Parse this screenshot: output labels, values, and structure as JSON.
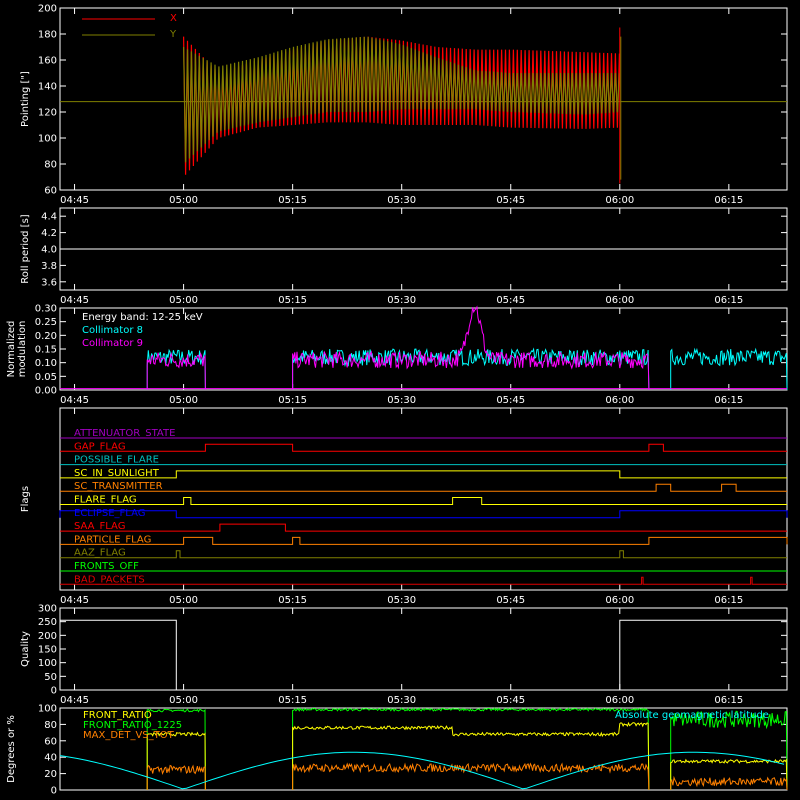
{
  "colors": {
    "red": "#ff0000",
    "olive": "#808000",
    "white": "#ffffff",
    "cyan": "#00ffff",
    "magenta": "#ff00ff",
    "yellow": "#ffff00",
    "orange": "#ff8000",
    "blue": "#0000ff",
    "green": "#00ff00",
    "purple": "#a000c0",
    "teal": "#00c0c0",
    "darkred": "#e00000"
  },
  "chart_data": [
    {
      "type": "line",
      "ylabel": "Pointing [\"]",
      "ylim": [
        60,
        200
      ],
      "yticks": [
        "60",
        "80",
        "100",
        "120",
        "140",
        "160",
        "180",
        "200"
      ],
      "xticks": [
        "04:45",
        "05:00",
        "05:15",
        "05:30",
        "05:45",
        "06:00",
        "06:15"
      ],
      "series": [
        {
          "name": "X",
          "color": "red",
          "envelope_upper": [
            178,
            150,
            160,
            168,
            175,
            178,
            175,
            170,
            168,
            168,
            166,
            165
          ],
          "envelope_lower": [
            70,
            100,
            108,
            110,
            112,
            112,
            110,
            110,
            110,
            108,
            107,
            108
          ]
        },
        {
          "name": "Y",
          "color": "olive",
          "envelope_upper": [
            170,
            155,
            162,
            170,
            176,
            178,
            172,
            162,
            152,
            150,
            150,
            150
          ],
          "envelope_lower": [
            80,
            105,
            112,
            116,
            120,
            120,
            122,
            122,
            122,
            120,
            118,
            120
          ]
        }
      ],
      "x_hours": [
        5.0,
        5.08,
        5.17,
        5.25,
        5.33,
        5.42,
        5.5,
        5.58,
        5.67,
        5.75,
        5.92,
        6.0
      ],
      "baseline": 128
    },
    {
      "type": "line",
      "ylabel": "Roll period [s]",
      "ylim": [
        3.5,
        4.5
      ],
      "yticks": [
        "3.6",
        "3.8",
        "4.0",
        "4.2",
        "4.4"
      ],
      "xticks": [
        "04:45",
        "05:00",
        "05:15",
        "05:30",
        "05:45",
        "06:00",
        "06:15"
      ],
      "series": [
        {
          "name": "",
          "color": "white",
          "x": [
            "04:43",
            "06:23"
          ],
          "y": [
            4.0,
            4.0
          ]
        }
      ]
    },
    {
      "type": "line",
      "ylabel": "Normalized modulation",
      "ylim": [
        0,
        0.3
      ],
      "yticks": [
        "0.00",
        "0.05",
        "0.10",
        "0.15",
        "0.20",
        "0.25",
        "0.30"
      ],
      "xticks": [
        "04:45",
        "05:00",
        "05:15",
        "05:30",
        "05:45",
        "06:00",
        "06:15"
      ],
      "legend": [
        "Energy band: 12-25 keV",
        "Collimator 8",
        "Collimator 9"
      ],
      "series": [
        {
          "name": "Collimator 8",
          "color": "cyan",
          "segments": [
            [
              "04:55",
              "05:03"
            ],
            [
              "05:15",
              "06:04"
            ],
            [
              "06:07",
              "06:23"
            ]
          ],
          "level": 0.12
        },
        {
          "name": "Collimator 9",
          "color": "magenta",
          "segments": [
            [
              "04:55",
              "05:03"
            ],
            [
              "05:15",
              "06:04"
            ]
          ],
          "level": 0.11,
          "peak": {
            "x": "05:40",
            "y": 0.31
          }
        }
      ]
    },
    {
      "type": "line",
      "ylabel": "Flags",
      "xticks": [
        "04:45",
        "05:00",
        "05:15",
        "05:30",
        "05:45",
        "06:00",
        "06:15"
      ],
      "flags": [
        {
          "name": "ATTENUATOR_STATE",
          "color": "purple",
          "steps": []
        },
        {
          "name": "GAP_FLAG",
          "color": "red",
          "steps": [
            [
              "05:03",
              "05:15"
            ],
            [
              "06:04",
              "06:06"
            ]
          ]
        },
        {
          "name": "POSSIBLE_FLARE",
          "color": "teal",
          "steps": []
        },
        {
          "name": "SC_IN_SUNLIGHT",
          "color": "yellow",
          "steps": [
            [
              "04:59",
              "06:00"
            ]
          ]
        },
        {
          "name": "SC_TRANSMITTER",
          "color": "orange",
          "steps": [
            [
              "06:05",
              "06:07"
            ],
            [
              "06:14",
              "06:16"
            ]
          ]
        },
        {
          "name": "FLARE_FLAG",
          "color": "yellow",
          "steps": [
            [
              "05:00",
              "05:01"
            ],
            [
              "05:37",
              "05:41"
            ]
          ]
        },
        {
          "name": "ECLIPSE_FLAG",
          "color": "blue",
          "steps": [
            [
              "04:43",
              "04:59"
            ],
            [
              "06:00",
              "06:23"
            ]
          ]
        },
        {
          "name": "SAA_FLAG",
          "color": "red",
          "steps": [
            [
              "05:05",
              "05:14"
            ]
          ]
        },
        {
          "name": "PARTICLE_FLAG",
          "color": "orange",
          "steps": [
            [
              "05:00",
              "05:04"
            ],
            [
              "05:15",
              "05:16"
            ],
            [
              "06:04",
              "06:23"
            ]
          ]
        },
        {
          "name": "AAZ_FLAG",
          "color": "olive",
          "steps": [
            [
              "04:59",
              "04:59.5"
            ],
            [
              "06:00",
              "06:00.5"
            ]
          ]
        },
        {
          "name": "FRONTS_OFF",
          "color": "green",
          "steps": []
        },
        {
          "name": "BAD_PACKETS",
          "color": "darkred",
          "steps": [
            [
              "06:03",
              "06:03.2"
            ],
            [
              "06:18",
              "06:18.2"
            ]
          ]
        }
      ]
    },
    {
      "type": "line",
      "ylabel": "Quality",
      "ylim": [
        0,
        300
      ],
      "yticks": [
        "0",
        "50",
        "100",
        "150",
        "200",
        "250",
        "300"
      ],
      "xticks": [
        "04:45",
        "05:00",
        "05:15",
        "05:30",
        "05:45",
        "06:00",
        "06:15"
      ],
      "series": [
        {
          "name": "",
          "color": "white",
          "x": [
            "04:43",
            "04:59",
            "04:59",
            "06:00",
            "06:00",
            "06:23"
          ],
          "y": [
            255,
            255,
            0,
            0,
            255,
            255
          ]
        }
      ]
    },
    {
      "type": "line",
      "ylabel": "Degrees or %",
      "ylim": [
        0,
        100
      ],
      "yticks": [
        "0",
        "20",
        "40",
        "60",
        "80",
        "100"
      ],
      "legend": [
        "FRONT_RATIO",
        "FRONT_RATIO_1225",
        "MAX_DET_VS_TOT",
        "Absolute geomagnetic latitude"
      ],
      "series": [
        {
          "name": "FRONT_RATIO",
          "color": "yellow"
        },
        {
          "name": "FRONT_RATIO_1225",
          "color": "green"
        },
        {
          "name": "MAX_DET_VS_TOT",
          "color": "orange"
        },
        {
          "name": "Absolute geomagnetic latitude",
          "color": "cyan"
        }
      ]
    }
  ]
}
